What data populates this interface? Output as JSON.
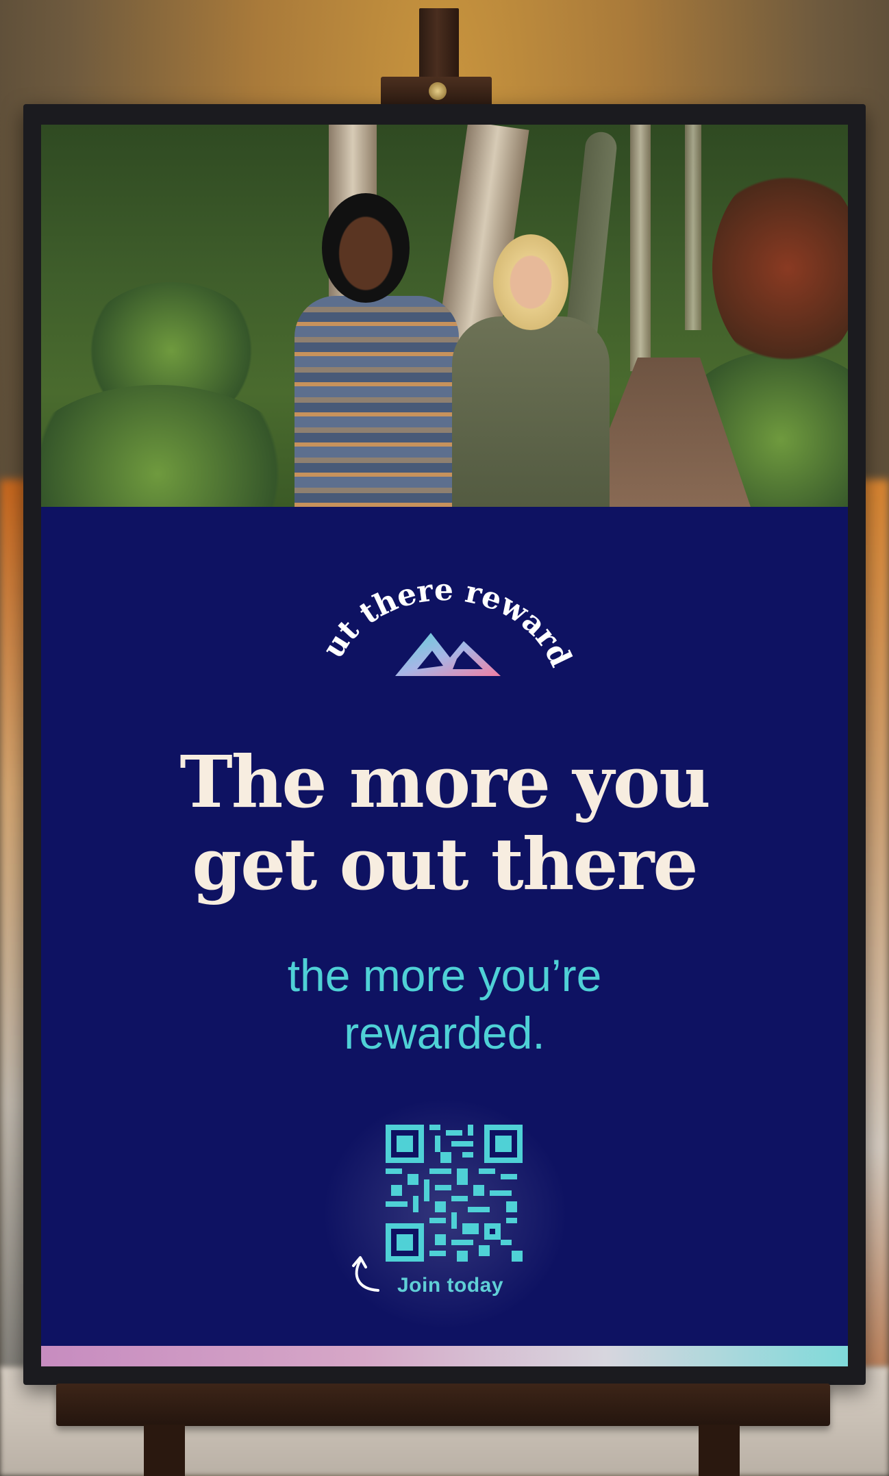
{
  "poster": {
    "brand_logo_text": "Out there rewards",
    "headline_line1": "The more you",
    "headline_line2": "get out there",
    "subline_line1": "the more you’re",
    "subline_line2": "rewarded.",
    "cta": "Join today"
  },
  "colors": {
    "poster_background": "#0e1262",
    "headline": "#f7ede0",
    "accent_teal": "#4fd1d6"
  }
}
